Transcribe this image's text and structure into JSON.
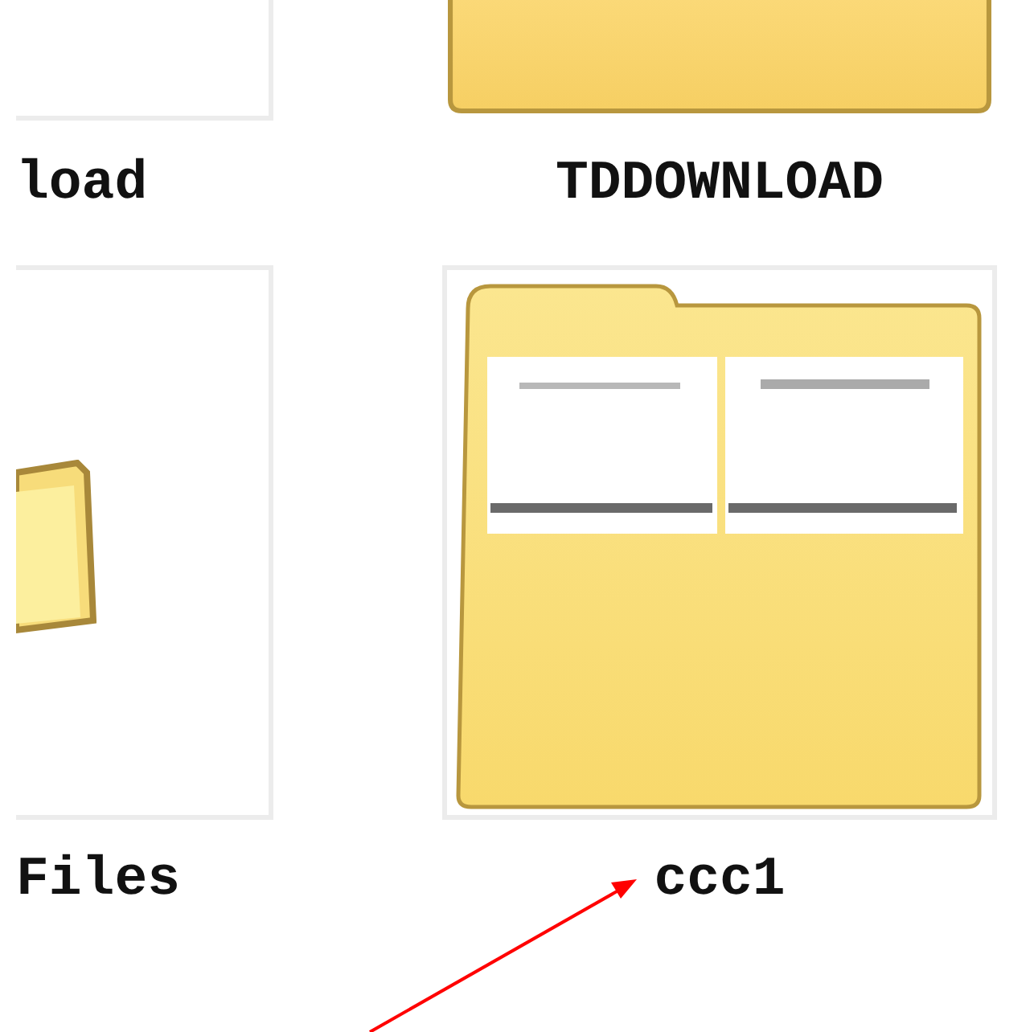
{
  "items": [
    {
      "name": "load",
      "kind": "blank"
    },
    {
      "name": "TDDOWNLOAD",
      "kind": "folder"
    },
    {
      "name": "Files",
      "kind": "small-folder"
    },
    {
      "name": "ccc1",
      "kind": "preview-folder"
    }
  ]
}
